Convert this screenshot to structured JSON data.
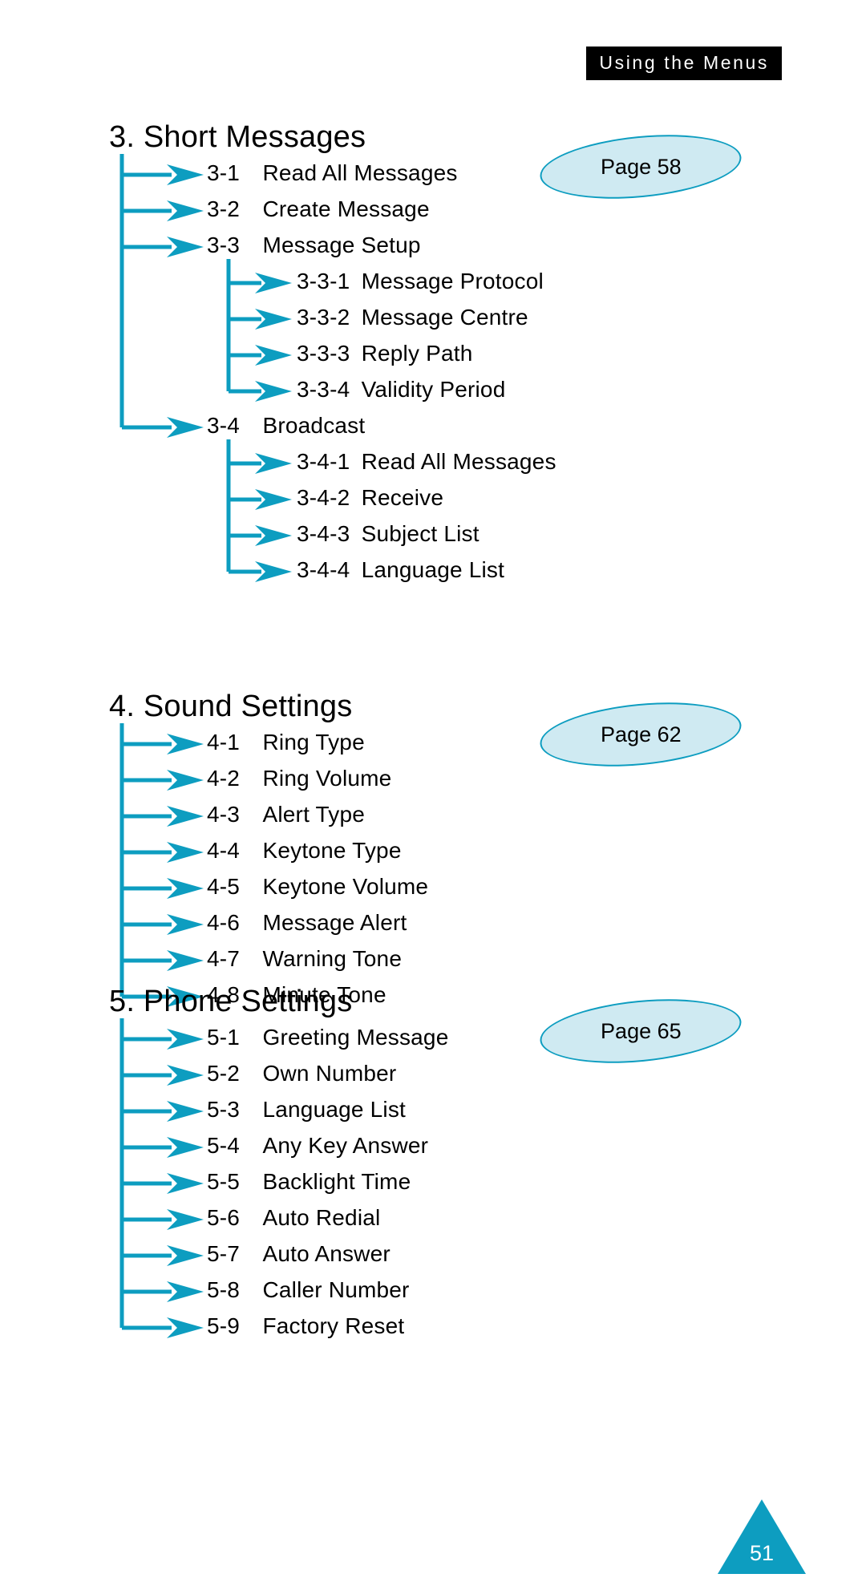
{
  "header": {
    "running_head": "Using the Menus"
  },
  "footer": {
    "page_number": "51"
  },
  "colors": {
    "accent": "#0d9dc0",
    "bubble_fill": "#cfeaf2",
    "text": "#000000",
    "header_band_bg": "#000000",
    "header_band_text": "#ffffff"
  },
  "sections": [
    {
      "id": "short-messages",
      "title": "3. Short Messages",
      "page_label": "Page 58",
      "items": [
        {
          "num": "3-1",
          "label": "Read All Messages",
          "level": 1
        },
        {
          "num": "3-2",
          "label": "Create Message",
          "level": 1
        },
        {
          "num": "3-3",
          "label": "Message Setup",
          "level": 1
        },
        {
          "num": "3-3-1",
          "label": "Message Protocol",
          "level": 2
        },
        {
          "num": "3-3-2",
          "label": "Message Centre",
          "level": 2
        },
        {
          "num": "3-3-3",
          "label": "Reply Path",
          "level": 2
        },
        {
          "num": "3-3-4",
          "label": "Validity Period",
          "level": 2
        },
        {
          "num": "3-4",
          "label": "Broadcast",
          "level": 1
        },
        {
          "num": "3-4-1",
          "label": "Read All Messages",
          "level": 2
        },
        {
          "num": "3-4-2",
          "label": "Receive",
          "level": 2
        },
        {
          "num": "3-4-3",
          "label": "Subject List",
          "level": 2
        },
        {
          "num": "3-4-4",
          "label": "Language List",
          "level": 2
        }
      ]
    },
    {
      "id": "sound-settings",
      "title": "4. Sound Settings",
      "page_label": "Page 62",
      "items": [
        {
          "num": "4-1",
          "label": "Ring Type",
          "level": 1
        },
        {
          "num": "4-2",
          "label": "Ring Volume",
          "level": 1
        },
        {
          "num": "4-3",
          "label": "Alert Type",
          "level": 1
        },
        {
          "num": "4-4",
          "label": "Keytone Type",
          "level": 1
        },
        {
          "num": "4-5",
          "label": "Keytone Volume",
          "level": 1
        },
        {
          "num": "4-6",
          "label": "Message Alert",
          "level": 1
        },
        {
          "num": "4-7",
          "label": "Warning Tone",
          "level": 1
        },
        {
          "num": "4-8",
          "label": "Minute Tone",
          "level": 1
        }
      ]
    },
    {
      "id": "phone-settings",
      "title": "5. Phone Settings",
      "page_label": "Page 65",
      "items": [
        {
          "num": "5-1",
          "label": "Greeting Message",
          "level": 1
        },
        {
          "num": "5-2",
          "label": "Own Number",
          "level": 1
        },
        {
          "num": "5-3",
          "label": "Language List",
          "level": 1
        },
        {
          "num": "5-4",
          "label": "Any Key Answer",
          "level": 1
        },
        {
          "num": "5-5",
          "label": "Backlight Time",
          "level": 1
        },
        {
          "num": "5-6",
          "label": "Auto Redial",
          "level": 1
        },
        {
          "num": "5-7",
          "label": "Auto Answer",
          "level": 1
        },
        {
          "num": "5-8",
          "label": "Caller Number",
          "level": 1
        },
        {
          "num": "5-9",
          "label": "Factory Reset",
          "level": 1
        }
      ]
    }
  ]
}
